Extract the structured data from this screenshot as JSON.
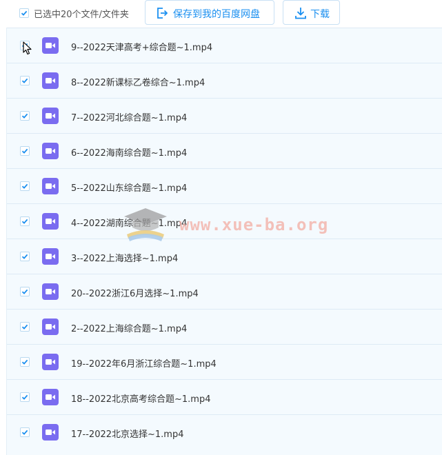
{
  "toolbar": {
    "selection_text": "已选中20个文件/文件夹",
    "save_label": "保存到我的百度网盘",
    "download_label": "下载"
  },
  "files": [
    {
      "name": "9--2022天津高考+综合题~1.mp4",
      "checked": true
    },
    {
      "name": "8--2022新课标乙卷综合~1.mp4",
      "checked": true
    },
    {
      "name": "7--2022河北综合题~1.mp4",
      "checked": true
    },
    {
      "name": "6--2022海南综合题~1.mp4",
      "checked": true
    },
    {
      "name": "5--2022山东综合题~1.mp4",
      "checked": true
    },
    {
      "name": "4--2022湖南综合题~1.mp4",
      "checked": true
    },
    {
      "name": "3--2022上海选择~1.mp4",
      "checked": true
    },
    {
      "name": "20--2022浙江6月选择~1.mp4",
      "checked": true
    },
    {
      "name": "2--2022上海综合题~1.mp4",
      "checked": true
    },
    {
      "name": "19--2022年6月浙江综合题~1.mp4",
      "checked": true
    },
    {
      "name": "18--2022北京高考综合题~1.mp4",
      "checked": true
    },
    {
      "name": "17--2022北京选择~1.mp4",
      "checked": true
    }
  ],
  "watermark": {
    "text": "www.xue-ba.org"
  },
  "colors": {
    "accent": "#1a8ff0",
    "video_icon": "#7a6cf0",
    "row_bg": "#f4fafe",
    "watermark": "#f3b2a8"
  },
  "icons": {
    "file": "video-file-icon",
    "save": "save-to-cloud-icon",
    "download": "download-icon",
    "check": "check-icon"
  }
}
